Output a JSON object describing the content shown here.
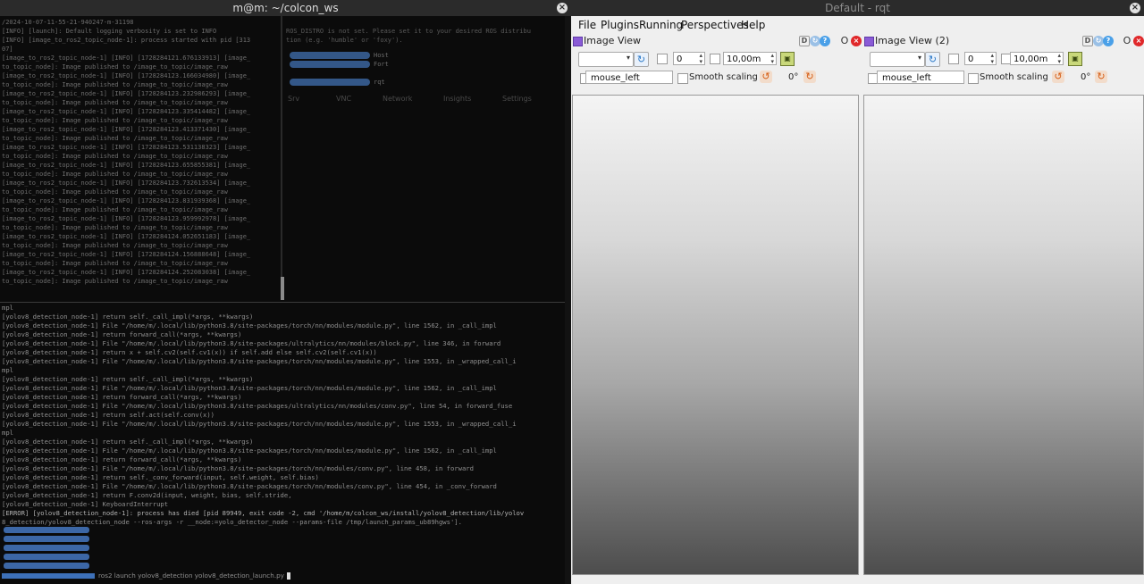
{
  "terminal": {
    "title": "m@m: ~/colcon_ws",
    "top_pane_lines": [
      "/2024-10-07-11-55-21-940247-m-31198",
      "[INFO] [launch]: Default logging verbosity is set to INFO",
      "[INFO] [image_to_ros2_topic_node-1]: process started with pid [313",
      "07]",
      "[image_to_ros2_topic_node-1] [INFO] [1728284121.676133913] [image_",
      "to_topic_node]: Image published to /image_to_topic/image_raw",
      "[image_to_ros2_topic_node-1] [INFO] [1728284123.166034980] [image_",
      "to_topic_node]: Image published to /image_to_topic/image_raw",
      "[image_to_ros2_topic_node-1] [INFO] [1728284123.232986293] [image_",
      "to_topic_node]: Image published to /image_to_topic/image_raw",
      "[image_to_ros2_topic_node-1] [INFO] [1728284123.335414482] [image_",
      "to_topic_node]: Image published to /image_to_topic/image_raw",
      "[image_to_ros2_topic_node-1] [INFO] [1728284123.413371430] [image_",
      "to_topic_node]: Image published to /image_to_topic/image_raw",
      "[image_to_ros2_topic_node-1] [INFO] [1728284123.531138323] [image_",
      "to_topic_node]: Image published to /image_to_topic/image_raw",
      "[image_to_ros2_topic_node-1] [INFO] [1728284123.655855381] [image_",
      "to_topic_node]: Image published to /image_to_topic/image_raw",
      "[image_to_ros2_topic_node-1] [INFO] [1728284123.732613534] [image_",
      "to_topic_node]: Image published to /image_to_topic/image_raw",
      "[image_to_ros2_topic_node-1] [INFO] [1728284123.831939368] [image_",
      "to_topic_node]: Image published to /image_to_topic/image_raw",
      "[image_to_ros2_topic_node-1] [INFO] [1728284123.959992978] [image_",
      "to_topic_node]: Image published to /image_to_topic/image_raw",
      "[image_to_ros2_topic_node-1] [INFO] [1728284124.052651183] [image_",
      "to_topic_node]: Image published to /image_to_topic/image_raw",
      "[image_to_ros2_topic_node-1] [INFO] [1728284124.156888648] [image_",
      "to_topic_node]: Image published to /image_to_topic/image_raw",
      "[image_to_ros2_topic_node-1] [INFO] [1728284124.252083038] [image_",
      "to_topic_node]: Image published to /image_to_topic/image_raw"
    ],
    "ghost_lines": [
      "ROS_DISTRO is not set. Please set it to your desired ROS distribu",
      "tion (e.g. 'humble' or 'foxy')."
    ],
    "ghost_nodes": [
      "Host",
      "Fort",
      "rqt"
    ],
    "ghost_tabs": [
      "Srv",
      "VNC",
      "Network",
      "Insights",
      "Settings"
    ],
    "bottom_pane_lines": [
      "mpl",
      "[yolov8_detection_node-1]     return self._call_impl(*args, **kwargs)",
      "[yolov8_detection_node-1]   File \"/home/m/.local/lib/python3.8/site-packages/torch/nn/modules/module.py\", line 1562, in _call_impl",
      "[yolov8_detection_node-1]     return forward_call(*args, **kwargs)",
      "[yolov8_detection_node-1]   File \"/home/m/.local/lib/python3.8/site-packages/ultralytics/nn/modules/block.py\", line 346, in forward",
      "[yolov8_detection_node-1]     return x + self.cv2(self.cv1(x)) if self.add else self.cv2(self.cv1(x))",
      "[yolov8_detection_node-1]   File \"/home/m/.local/lib/python3.8/site-packages/torch/nn/modules/module.py\", line 1553, in _wrapped_call_i",
      "mpl",
      "[yolov8_detection_node-1]     return self._call_impl(*args, **kwargs)",
      "[yolov8_detection_node-1]   File \"/home/m/.local/lib/python3.8/site-packages/torch/nn/modules/module.py\", line 1562, in _call_impl",
      "[yolov8_detection_node-1]     return forward_call(*args, **kwargs)",
      "[yolov8_detection_node-1]   File \"/home/m/.local/lib/python3.8/site-packages/ultralytics/nn/modules/conv.py\", line 54, in forward_fuse",
      "[yolov8_detection_node-1]     return self.act(self.conv(x))",
      "[yolov8_detection_node-1]   File \"/home/m/.local/lib/python3.8/site-packages/torch/nn/modules/module.py\", line 1553, in _wrapped_call_i",
      "mpl",
      "[yolov8_detection_node-1]     return self._call_impl(*args, **kwargs)",
      "[yolov8_detection_node-1]   File \"/home/m/.local/lib/python3.8/site-packages/torch/nn/modules/module.py\", line 1562, in _call_impl",
      "[yolov8_detection_node-1]     return forward_call(*args, **kwargs)",
      "[yolov8_detection_node-1]   File \"/home/m/.local/lib/python3.8/site-packages/torch/nn/modules/conv.py\", line 458, in forward",
      "[yolov8_detection_node-1]     return self._conv_forward(input, self.weight, self.bias)",
      "[yolov8_detection_node-1]   File \"/home/m/.local/lib/python3.8/site-packages/torch/nn/modules/conv.py\", line 454, in _conv_forward",
      "[yolov8_detection_node-1]     return F.conv2d(input, weight, bias, self.stride,",
      "[yolov8_detection_node-1] KeyboardInterrupt",
      "[ERROR] [yolov8_detection_node-1]: process has died [pid 89949, exit code -2, cmd '/home/m/colcon_ws/install/yolov8_detection/lib/yolov",
      "8_detection/yolov8_detection_node --ros-args -r __node:=yolo_detector_node --params-file /tmp/launch_params_ub89hgws']."
    ],
    "prompt_command": "ros2 launch yolov8_detection yolov8_detection_launch.py"
  },
  "rqt": {
    "title": "Default - rqt",
    "menus": [
      "File",
      "Plugins",
      "Running",
      "Perspectives",
      "Help"
    ],
    "plugins": [
      {
        "title": "Image View",
        "spin_value": "0",
        "zoom_value": "10,00m",
        "topic_value": "mouse_left",
        "smooth_label": "Smooth scaling",
        "rotation": "0°",
        "btn_d": "D",
        "btn_min": "O"
      },
      {
        "title": "Image View (2)",
        "spin_value": "0",
        "zoom_value": "10,00m",
        "topic_value": "mouse_left",
        "smooth_label": "Smooth scaling",
        "rotation": "0°",
        "btn_d": "D",
        "btn_min": "O"
      }
    ]
  }
}
